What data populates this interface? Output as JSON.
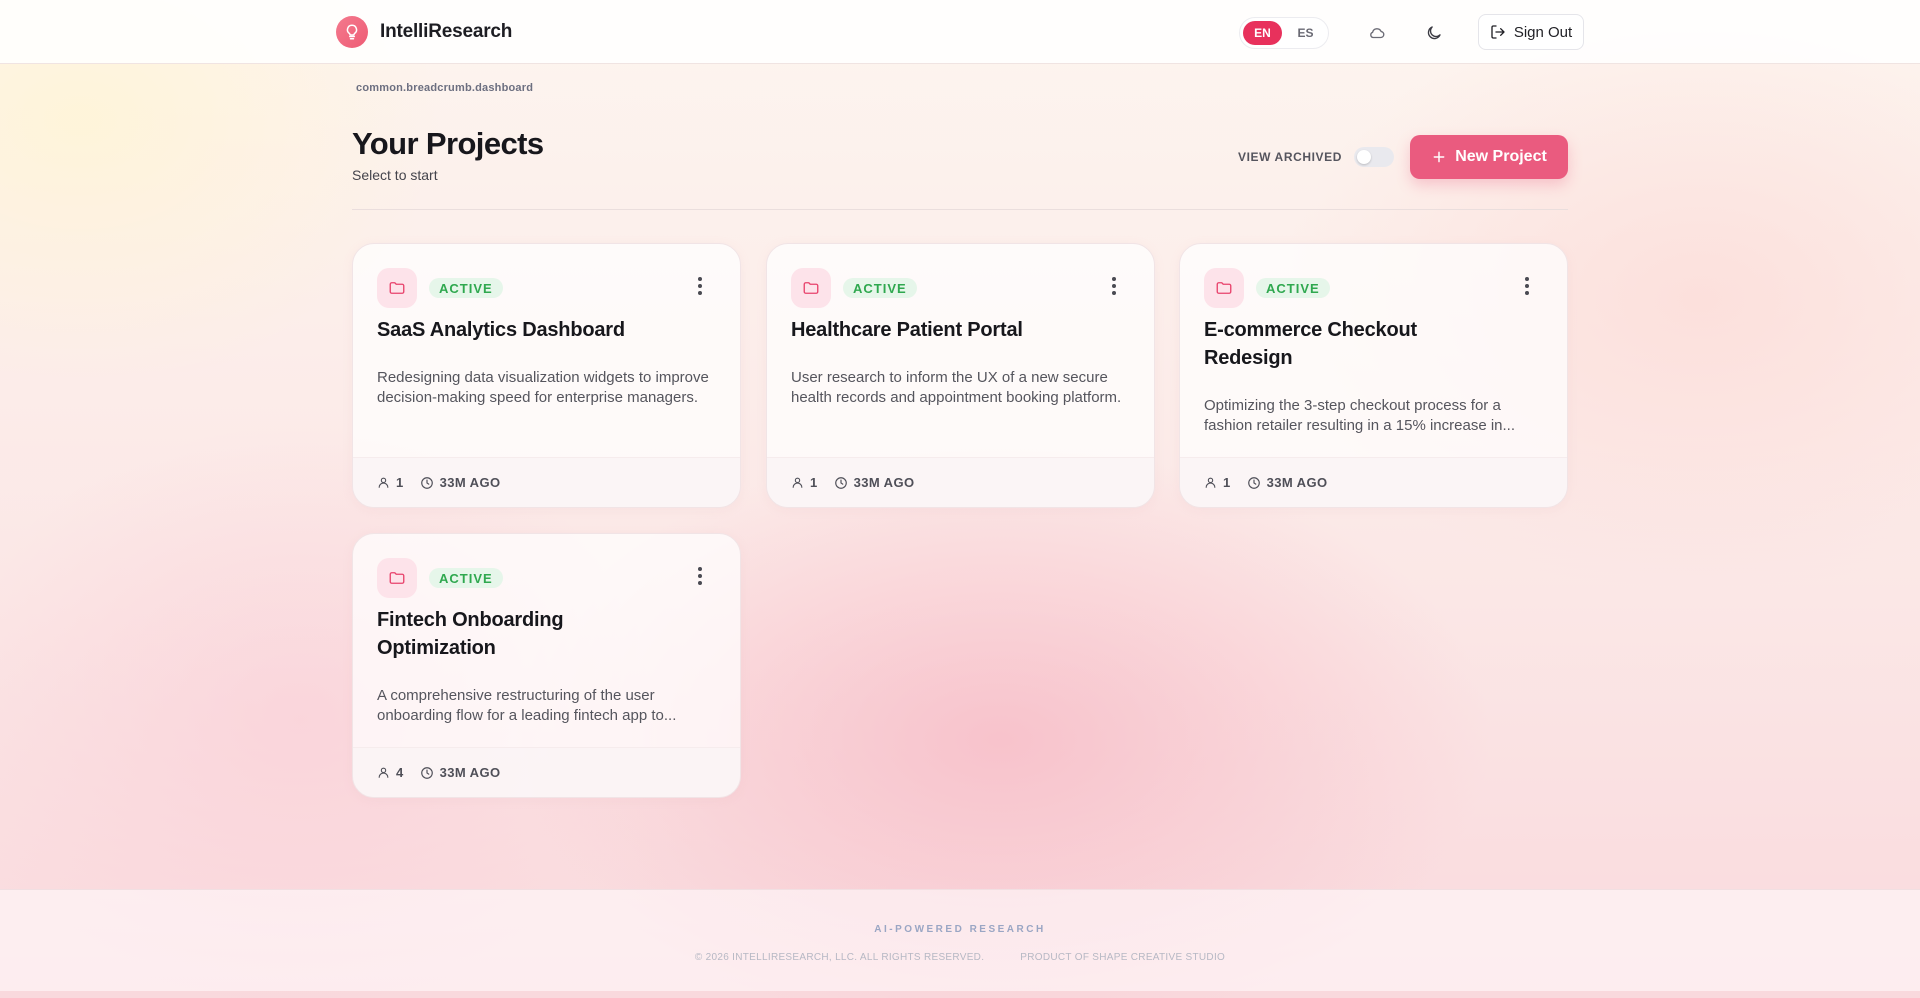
{
  "header": {
    "brand_name": "IntelliResearch",
    "brand_icon": "lightbulb-icon",
    "languages": [
      "EN",
      "ES"
    ],
    "active_language": "EN",
    "weather_icon": "cloud-icon",
    "theme_icon": "moon-icon",
    "signout_label": "Sign Out",
    "accent_color": "#e8315c"
  },
  "breadcrumb": "common.breadcrumb.dashboard",
  "page": {
    "title": "Your Projects",
    "subtitle": "Select to start",
    "view_archived_label": "VIEW ARCHIVED",
    "view_archived_on": false,
    "new_project_label": "New Project"
  },
  "projects": [
    {
      "status": "ACTIVE",
      "title": "SaaS Analytics Dashboard",
      "description": "Redesigning data visualization widgets to improve decision-making speed for enterprise managers.",
      "members": "1",
      "updated": "33M AGO"
    },
    {
      "status": "ACTIVE",
      "title": "Healthcare Patient Portal",
      "description": "User research to inform the UX of a new secure health records and appointment booking platform.",
      "members": "1",
      "updated": "33M AGO"
    },
    {
      "status": "ACTIVE",
      "title": "E-commerce Checkout Redesign",
      "description": "Optimizing the 3-step checkout process for a fashion retailer resulting in a 15% increase in...",
      "members": "1",
      "updated": "33M AGO"
    },
    {
      "status": "ACTIVE",
      "title": "Fintech Onboarding Optimization",
      "description": "A comprehensive restructuring of the user onboarding flow for a leading fintech app to...",
      "members": "4",
      "updated": "33M AGO"
    }
  ],
  "footer": {
    "tagline": "AI-POWERED RESEARCH",
    "copyright": "© 2026 INTELLIRESEARCH, LLC. ALL RIGHTS RESERVED.",
    "credit": "PRODUCT OF SHAPE CREATIVE STUDIO"
  }
}
